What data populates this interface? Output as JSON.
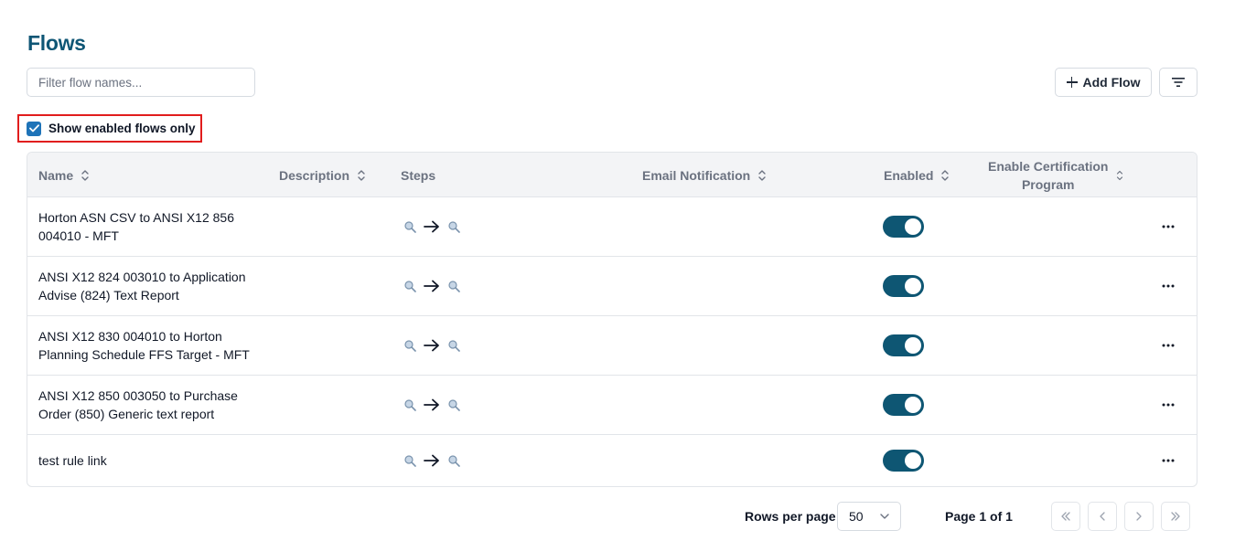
{
  "page": {
    "title": "Flows"
  },
  "filter": {
    "placeholder": "Filter flow names..."
  },
  "toolbar": {
    "add_label": "Add Flow",
    "filter_icon": "filter-lines-icon"
  },
  "enabled_only": {
    "label": "Show enabled flows only",
    "checked": true
  },
  "table": {
    "columns": {
      "name": "Name",
      "description": "Description",
      "steps": "Steps",
      "email": "Email Notification",
      "enabled": "Enabled",
      "cert_line1": "Enable Certification",
      "cert_line2": "Program"
    },
    "rows": [
      {
        "name": "Horton ASN CSV to ANSI X12 856 004010 - MFT",
        "enabled": true
      },
      {
        "name": "ANSI X12 824 003010 to Application Advise (824) Text Report",
        "enabled": true
      },
      {
        "name": "ANSI X12 830 004010 to Horton Planning Schedule FFS Target - MFT",
        "enabled": true
      },
      {
        "name": "ANSI X12 850 003050 to Purchase Order (850) Generic text report",
        "enabled": true
      },
      {
        "name": "test rule link",
        "enabled": true
      }
    ]
  },
  "pagination": {
    "rows_per_page_label": "Rows per page",
    "rows_per_page_value": "50",
    "page_info": "Page 1 of 1"
  },
  "colors": {
    "accent": "#0e5673",
    "title": "#0f5675",
    "checkbox": "#1e73b8",
    "highlight_border": "#e11d1d"
  }
}
